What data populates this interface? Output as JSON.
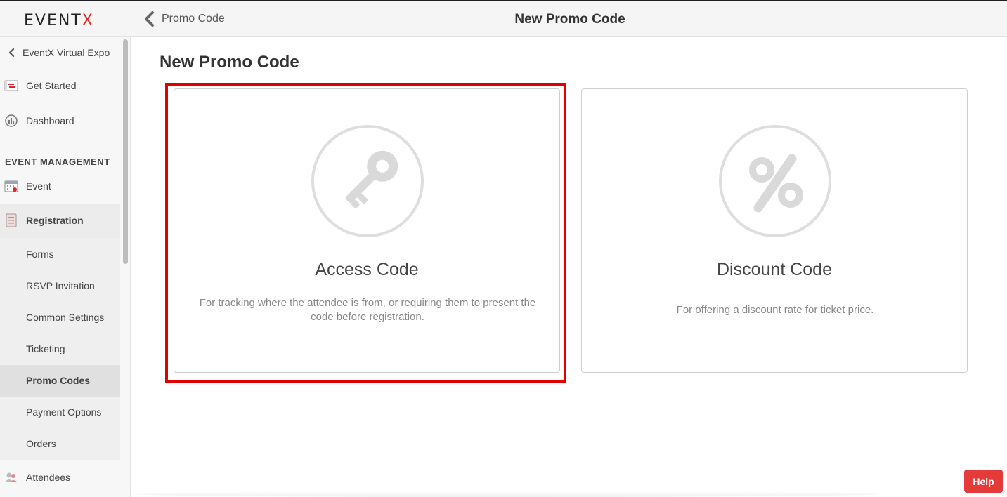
{
  "app": {
    "logo_text_1": "EVENT",
    "logo_text_2": "X",
    "accent": "#e42525"
  },
  "topbar": {
    "back_label": "Promo Code",
    "title": "New Promo Code"
  },
  "sidebar": {
    "back_label": "EventX Virtual Expo",
    "items_top": [
      {
        "label": "Get Started",
        "icon": "get-started-icon"
      },
      {
        "label": "Dashboard",
        "icon": "dashboard-icon"
      }
    ],
    "section_label": "EVENT MANAGEMENT",
    "event_label": "Event",
    "registration_label": "Registration",
    "sub_items": [
      "Forms",
      "RSVP Invitation",
      "Common Settings",
      "Ticketing",
      "Promo Codes",
      "Payment Options",
      "Orders"
    ],
    "attendees_label": "Attendees"
  },
  "main": {
    "heading": "New Promo Code",
    "cards": [
      {
        "title": "Access Code",
        "description": "For tracking where the attendee is from, or requiring them to present the code before registration.",
        "icon": "key-icon",
        "selected": true
      },
      {
        "title": "Discount Code",
        "description": "For offering a discount rate for ticket price.",
        "icon": "percent-icon",
        "selected": false
      }
    ]
  },
  "help_label": "Help",
  "colors": {
    "highlight": "#e00000",
    "help_button": "#e43a3a"
  }
}
